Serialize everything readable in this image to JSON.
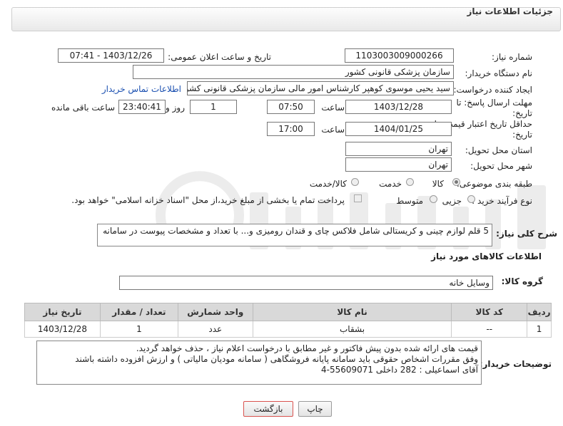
{
  "header": {
    "title": "جزئیات اطلاعات نیاز"
  },
  "form": {
    "need_number": {
      "label": "شماره نیاز:",
      "value": "1103003009000266"
    },
    "announce_datetime": {
      "label": "تاریخ و ساعت اعلان عمومی:",
      "value": "1403/12/26 - 07:41"
    },
    "buyer_org": {
      "label": "نام دستگاه خریدار:",
      "value": "سازمان پزشکی قانونی کشور"
    },
    "requester": {
      "label": "ایجاد کننده درخواست:",
      "value": "سید یحیی موسوی کوهپر کارشناس امور مالی سازمان پزشکی قانونی کشور",
      "contact_link": "اطلاعات تماس خریدار"
    },
    "reply_deadline": {
      "label": "مهلت ارسال پاسخ: تا تاریخ:",
      "date": "1403/12/28",
      "time_label": "ساعت",
      "time": "07:50",
      "days": "1",
      "days_label": "روز و",
      "remaining": "23:40:41",
      "remaining_label": "ساعت باقی مانده"
    },
    "price_validity": {
      "label": "حداقل تاریخ اعتبار قیمت: تا تاریخ:",
      "date": "1404/01/25",
      "time_label": "ساعت",
      "time": "17:00"
    },
    "province": {
      "label": "استان محل تحویل:",
      "value": "تهران"
    },
    "city": {
      "label": "شهر محل تحویل:",
      "value": "تهران"
    },
    "category": {
      "label": "طبقه بندی موضوعی:",
      "options": [
        "کالا",
        "خدمت",
        "کالا/خدمت"
      ],
      "selected": "کالا"
    },
    "purchase_type": {
      "label": "نوع فرآیند خرید :",
      "options": [
        "جزیی",
        "متوسط"
      ],
      "payment_note": "پرداخت تمام یا بخشی از مبلغ خرید،از محل \"اسناد خزانه اسلامی\" خواهد بود."
    },
    "description": {
      "label": "شرح کلی نیاز:",
      "value": "5 قلم لوازم چینی و کریستالی شامل فلاکس چای و قندان رومیزی  و... با تعداد و مشخصات پیوست در سامانه"
    }
  },
  "goods": {
    "section_title": "اطلاعات کالاهای مورد نیاز",
    "group_label": "گروه کالا:",
    "group_value": "وسایل خانه",
    "columns": [
      "ردیف",
      "کد کالا",
      "نام کالا",
      "واحد شمارش",
      "تعداد / مقدار",
      "تاریخ نیاز"
    ],
    "rows": [
      {
        "index": "1",
        "code": "--",
        "name": "بشقاب",
        "unit": "عدد",
        "qty": "1",
        "date": "1403/12/28"
      }
    ]
  },
  "buyer_notes": {
    "label": "توضیحات خریدار:",
    "lines": [
      "قیمت های ارائه شده بدون پیش فاکتور  و غیر مطابق با درخواست اعلام نیاز  ،  حذف خواهد گردید.",
      "وفق مقررات اشخاص حقوقی باید سامانه پایانه فروشگاهی ( سامانه مودیان مالیاتی ) و ارزش افزوده  داشته باشند",
      "آقای اسماعیلی  :   282   داخلی        55609071-4"
    ]
  },
  "buttons": {
    "print": "چاپ",
    "back": "بازگشت"
  },
  "colors": {
    "back_button_border": "#d9534f",
    "link": "#1a4fb0",
    "watermark": "#e6e6e6"
  }
}
